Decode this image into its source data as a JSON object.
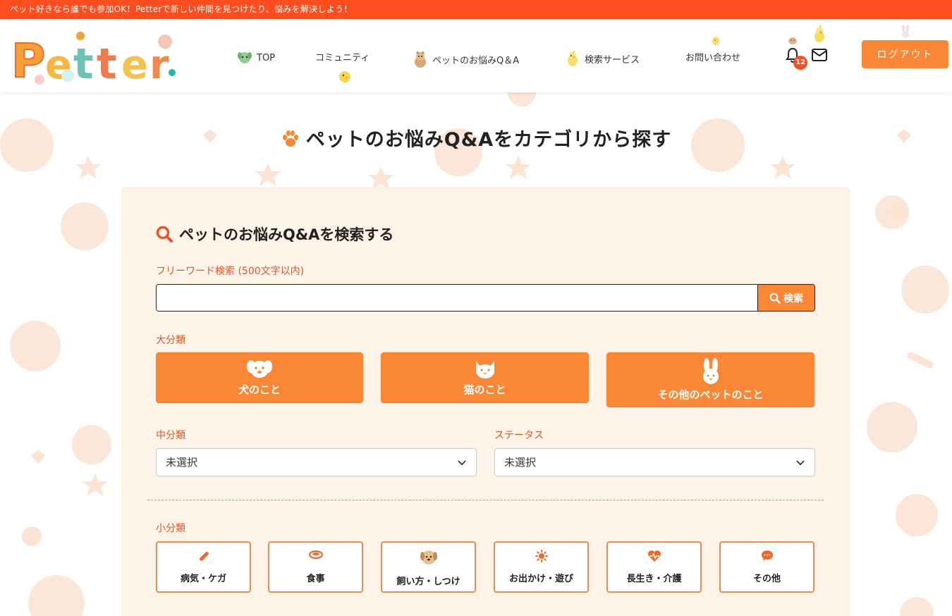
{
  "banner": {
    "text": "ペット好きなら誰でも参加OK！Petterで新しい仲間を見つけたり、悩みを解決しよう！"
  },
  "header": {
    "logo_text": "Petter",
    "nav": [
      {
        "label": "TOP",
        "icon": "dog-icon"
      },
      {
        "label": "コミュニティ",
        "icon": "chick-icon"
      },
      {
        "label": "ペットのお悩みQ＆A",
        "icon": "cat-icon"
      },
      {
        "label": "検索サービス",
        "icon": "bird-icon"
      },
      {
        "label": "お問い合わせ",
        "icon": "chick-icon"
      }
    ],
    "notification_count": "12",
    "logout_label": "ログアウト"
  },
  "page_title": "ペットのお悩みQ&Aをカテゴリから探す",
  "search_card": {
    "title": "ペットのお悩みQ&Aを検索する",
    "freeword_label": "フリーワード検索 (500文字以内)",
    "freeword_value": "",
    "search_button": "検索",
    "major_label": "大分類",
    "major_categories": [
      {
        "label": "犬のこと",
        "icon": "dog-face-icon"
      },
      {
        "label": "猫のこと",
        "icon": "cat-face-icon"
      },
      {
        "label": "その他のペットのこと",
        "icon": "rabbit-face-icon"
      }
    ],
    "middle_label": "中分類",
    "middle_value": "未選択",
    "status_label": "ステータス",
    "status_value": "未選択",
    "minor_label": "小分類",
    "minor_categories": [
      {
        "label": "病気・ケガ",
        "icon": "medicine-icon"
      },
      {
        "label": "食事",
        "icon": "food-bowl-icon"
      },
      {
        "label": "飼い方・しつけ",
        "icon": "dog-icon"
      },
      {
        "label": "お出かけ・遊び",
        "icon": "sun-icon"
      },
      {
        "label": "長生き・介護",
        "icon": "heart-pulse-icon"
      },
      {
        "label": "その他",
        "icon": "chat-bubble-icon"
      }
    ]
  },
  "colors": {
    "banner": "#ff4d1f",
    "accent": "#f98736",
    "label": "#e8542a",
    "card_bg": "#fdf3e6"
  }
}
